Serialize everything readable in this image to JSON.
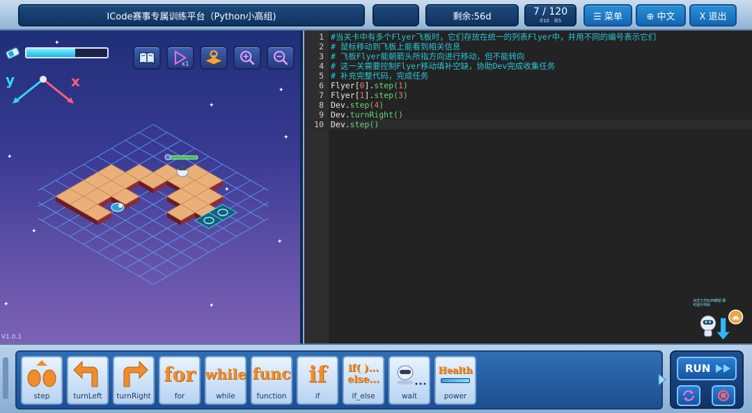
{
  "header": {
    "title": "ICode赛事专属训练平台（Python小高组)",
    "remaining": "剩余:56d",
    "progress": "7 / 120",
    "progress_sub1": "♁10",
    "progress_sub2": "☰5",
    "menu_label": "☰ 菜单",
    "lang_label": "⊕ 中文",
    "exit_label": "X 退出"
  },
  "game": {
    "version": "V1.0.1",
    "health_fraction": 0.6,
    "axis_y": "y",
    "axis_x": "x"
  },
  "editor": {
    "lines": [
      {
        "n": "1",
        "text": "#当关卡中有多个Flyer飞板时，它们存放在统一的列表Flyer中，并用不同的编号表示它们"
      },
      {
        "n": "2",
        "text": "# 鼠标移动到飞板上能看到相关信息"
      },
      {
        "n": "3",
        "text": "# 飞板Flyer能朝箭头所指方向进行移动，但不能转向"
      },
      {
        "n": "4",
        "text": "# 这一关需要控制Flyer移动填补空缺，协助Dev完成收集任务"
      },
      {
        "n": "5",
        "text": "# 补充完整代码，完成任务"
      },
      {
        "n": "6",
        "obj": "Flyer[",
        "num": "0",
        "obj2": "].",
        "meth": "step(",
        "arg": "1",
        "end": ")"
      },
      {
        "n": "7",
        "obj": "Flyer[",
        "num": "1",
        "obj2": "].",
        "meth": "step(",
        "arg": "3",
        "end": ")"
      },
      {
        "n": "8",
        "obj": "Dev.",
        "meth": "step(",
        "arg": "4",
        "end": ")"
      },
      {
        "n": "9",
        "obj": "Dev.",
        "meth": "turnRight()",
        "arg": "",
        "end": ""
      },
      {
        "n": "10",
        "obj": "Dev.",
        "meth": "step()",
        "arg": "",
        "end": ""
      }
    ],
    "helper_text": "点击下方RUN按钮 即可运行代码"
  },
  "blocks": [
    {
      "label": "step",
      "icon": "step-icon"
    },
    {
      "label": "turnLeft",
      "icon": "turn-left-icon"
    },
    {
      "label": "turnRight",
      "icon": "turn-right-icon"
    },
    {
      "label": "for",
      "icon": "for-icon",
      "glyph": "for"
    },
    {
      "label": "while",
      "icon": "while-icon",
      "glyph": "while"
    },
    {
      "label": "function",
      "icon": "func-icon",
      "glyph": "func"
    },
    {
      "label": "if",
      "icon": "if-icon",
      "glyph": "if"
    },
    {
      "label": "if_else",
      "icon": "if-else-icon",
      "glyph1": "if( )...",
      "glyph2": "else..."
    },
    {
      "label": "wait",
      "icon": "wait-icon"
    },
    {
      "label": "power",
      "icon": "power-icon",
      "glyph": "Health"
    }
  ],
  "run": {
    "label": "RUN"
  },
  "colors": {
    "accent": "#1566b2",
    "code_comment": "#27c5d8",
    "code_num": "#ff6b6b",
    "code_method": "#6cd37a",
    "block_orange": "#f08d2a"
  }
}
